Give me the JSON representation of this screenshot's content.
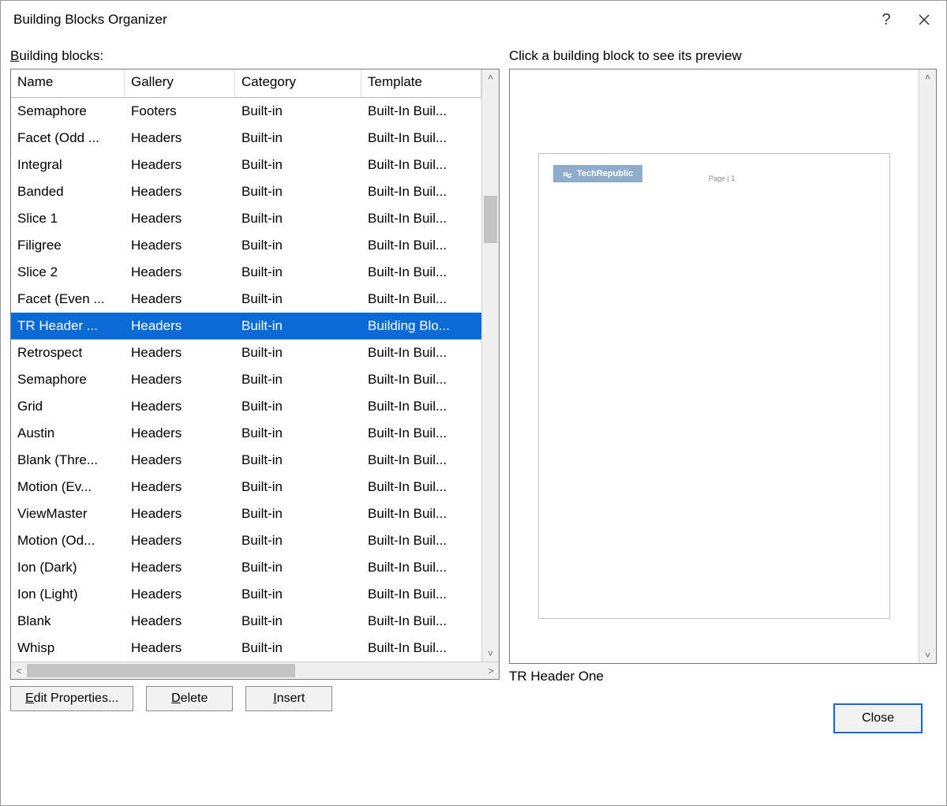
{
  "titlebar": {
    "title": "Building Blocks Organizer"
  },
  "section": {
    "building_blocks_label_prefix": "B",
    "building_blocks_label_rest": "uilding blocks:",
    "preview_label": "Click a building block to see its preview"
  },
  "columns": {
    "name": "Name",
    "gallery": "Gallery",
    "category": "Category",
    "template": "Template"
  },
  "rows": [
    {
      "name": "Semaphore",
      "gallery": "Footers",
      "category": "Built-in",
      "template": "Built-In Buil...",
      "selected": false
    },
    {
      "name": "Facet (Odd ...",
      "gallery": "Headers",
      "category": "Built-in",
      "template": "Built-In Buil...",
      "selected": false
    },
    {
      "name": "Integral",
      "gallery": "Headers",
      "category": "Built-in",
      "template": "Built-In Buil...",
      "selected": false
    },
    {
      "name": "Banded",
      "gallery": "Headers",
      "category": "Built-in",
      "template": "Built-In Buil...",
      "selected": false
    },
    {
      "name": "Slice 1",
      "gallery": "Headers",
      "category": "Built-in",
      "template": "Built-In Buil...",
      "selected": false
    },
    {
      "name": "Filigree",
      "gallery": "Headers",
      "category": "Built-in",
      "template": "Built-In Buil...",
      "selected": false
    },
    {
      "name": "Slice 2",
      "gallery": "Headers",
      "category": "Built-in",
      "template": "Built-In Buil...",
      "selected": false
    },
    {
      "name": "Facet (Even ...",
      "gallery": "Headers",
      "category": "Built-in",
      "template": "Built-In Buil...",
      "selected": false
    },
    {
      "name": "TR Header ...",
      "gallery": "Headers",
      "category": "Built-in",
      "template": "Building Blo...",
      "selected": true
    },
    {
      "name": "Retrospect",
      "gallery": "Headers",
      "category": "Built-in",
      "template": "Built-In Buil...",
      "selected": false
    },
    {
      "name": "Semaphore",
      "gallery": "Headers",
      "category": "Built-in",
      "template": "Built-In Buil...",
      "selected": false
    },
    {
      "name": "Grid",
      "gallery": "Headers",
      "category": "Built-in",
      "template": "Built-In Buil...",
      "selected": false
    },
    {
      "name": "Austin",
      "gallery": "Headers",
      "category": "Built-in",
      "template": "Built-In Buil...",
      "selected": false
    },
    {
      "name": " Blank (Thre...",
      "gallery": "Headers",
      "category": "Built-in",
      "template": "Built-In Buil...",
      "selected": false
    },
    {
      "name": "Motion (Ev...",
      "gallery": "Headers",
      "category": "Built-in",
      "template": "Built-In Buil...",
      "selected": false
    },
    {
      "name": "ViewMaster",
      "gallery": "Headers",
      "category": "Built-in",
      "template": "Built-In Buil...",
      "selected": false
    },
    {
      "name": "Motion (Od...",
      "gallery": "Headers",
      "category": "Built-in",
      "template": "Built-In Buil...",
      "selected": false
    },
    {
      "name": "Ion (Dark)",
      "gallery": "Headers",
      "category": "Built-in",
      "template": "Built-In Buil...",
      "selected": false
    },
    {
      "name": "Ion (Light)",
      "gallery": "Headers",
      "category": "Built-in",
      "template": "Built-In Buil...",
      "selected": false
    },
    {
      "name": " Blank",
      "gallery": "Headers",
      "category": "Built-in",
      "template": "Built-In Buil...",
      "selected": false
    },
    {
      "name": "Whisp",
      "gallery": "Headers",
      "category": "Built-in",
      "template": "Built-In Buil...",
      "selected": false
    }
  ],
  "buttons": {
    "edit_properties_prefix": "E",
    "edit_properties_rest": "dit Properties...",
    "delete_prefix": "D",
    "delete_rest": "elete",
    "insert_prefix": "I",
    "insert_rest": "nsert",
    "close": "Close"
  },
  "preview": {
    "caption": "TR Header One",
    "badge_text": "TechRepublic",
    "page_text": "Page | 1"
  }
}
